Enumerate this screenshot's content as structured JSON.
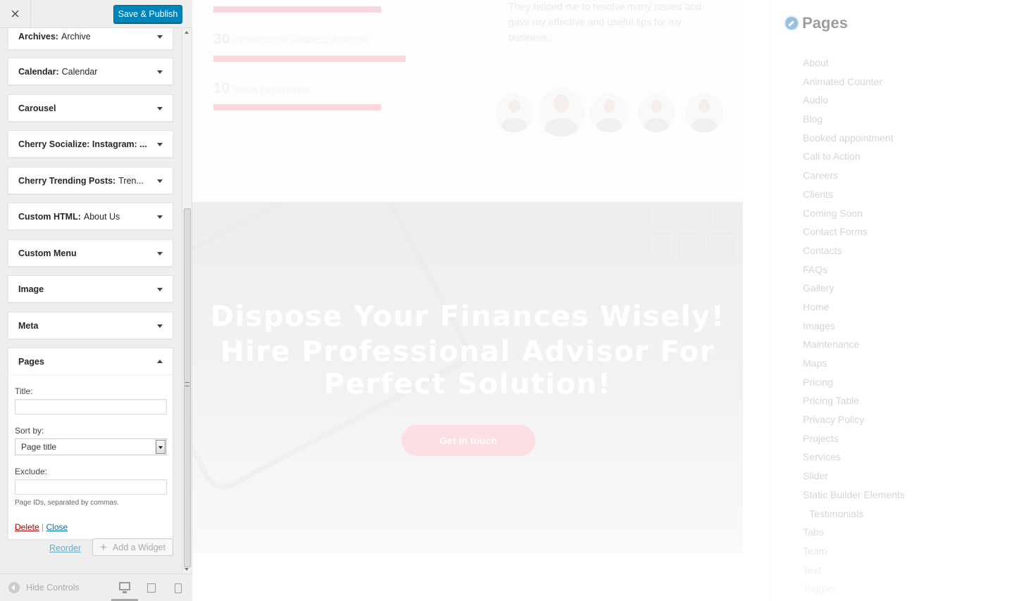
{
  "sidebar": {
    "close_icon": "×",
    "save_label": "Save & Publish",
    "widgets": [
      {
        "name": "Archives:",
        "sub": "Archive"
      },
      {
        "name": "Calendar:",
        "sub": "Calendar"
      },
      {
        "name": "Carousel",
        "sub": ""
      },
      {
        "name": "Cherry Socialize: Instagram: ...",
        "sub": ""
      },
      {
        "name": "Cherry Trending Posts:",
        "sub": "Tren..."
      },
      {
        "name": "Custom HTML:",
        "sub": "About Us"
      },
      {
        "name": "Custom Menu",
        "sub": ""
      },
      {
        "name": "Image",
        "sub": ""
      },
      {
        "name": "Meta",
        "sub": ""
      }
    ],
    "pages_widget": {
      "name": "Pages",
      "title_label": "Title:",
      "title_value": "",
      "sortby_label": "Sort by:",
      "sortby_value": "Page title",
      "exclude_label": "Exclude:",
      "exclude_value": "",
      "exclude_note": "Page IDs, separated by commas.",
      "delete_label": "Delete",
      "separator": "|",
      "close_label": "Close"
    },
    "reorder_label": "Reorder",
    "add_widget_label": "Add a Widget",
    "hide_controls_label": "Hide Controls"
  },
  "preview": {
    "stats": [
      {
        "number": "30",
        "label": "Professional Financial Advisors"
      },
      {
        "number": "10",
        "label": "Years Experience"
      }
    ],
    "testimonial_text": "They helped me to resolve many issues and gave my effective and useful tips for my business.",
    "hero": {
      "line1": "Dispose Your Finances Wisely!",
      "line2": "Hire Professional Advisor For",
      "line3": "Perfect Solution!",
      "cta_label": "Get in touch"
    },
    "pages_widget": {
      "title": "Pages",
      "items": [
        "About",
        "Animated Counter",
        "Audio",
        "Blog",
        "Booked appointment",
        "Call to Action",
        "Careers",
        "Clients",
        "Coming Soon",
        "Contact Forms",
        "Contacts",
        "FAQs",
        "Gallery",
        "Home",
        "Images",
        "Maintenance",
        "Maps",
        "Pricing",
        "Pricing Table",
        "Privacy Policy",
        "Projects",
        "Services",
        "Slider",
        "Static Builder Elements",
        "Testimonials",
        "Tabs",
        "Team",
        "Text",
        "Toggles"
      ]
    }
  },
  "colors": {
    "accent": "#0085ba",
    "bar_pink": "#f4a6b4",
    "link": "#0073aa",
    "delete": "#aa0000"
  }
}
